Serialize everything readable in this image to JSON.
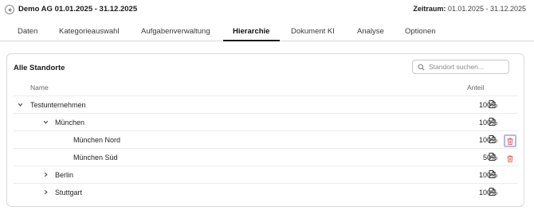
{
  "header": {
    "title": "Demo AG 01.01.2025 - 31.12.2025",
    "period_label": "Zeitraum:",
    "period_value": "01.01.2025 - 31.12.2025"
  },
  "tabs": [
    {
      "label": "Daten",
      "active": false
    },
    {
      "label": "Kategorieauswahl",
      "active": false
    },
    {
      "label": "Aufgabenverwaltung",
      "active": false
    },
    {
      "label": "Hierarchie",
      "active": true
    },
    {
      "label": "Dokument KI",
      "active": false
    },
    {
      "label": "Analyse",
      "active": false
    },
    {
      "label": "Optionen",
      "active": false
    }
  ],
  "panel": {
    "title": "Alle Standorte",
    "search_placeholder": "Standort suchen...",
    "columns": {
      "name": "Name",
      "share": "Anteil"
    },
    "rows": [
      {
        "name": "Testunternehmen",
        "share": "100%",
        "level": 0,
        "toggle": "expanded"
      },
      {
        "name": "München",
        "share": "100%",
        "level": 1,
        "toggle": "expanded"
      },
      {
        "name": "München Nord",
        "share": "100%",
        "level": 2,
        "toggle": "none",
        "deletable": true
      },
      {
        "name": "München Süd",
        "share": "50%",
        "level": 2,
        "toggle": "none",
        "deletable": true
      },
      {
        "name": "Berlin",
        "share": "100%",
        "level": 1,
        "toggle": "collapsed"
      },
      {
        "name": "Stuttgart",
        "share": "100%",
        "level": 1,
        "toggle": "collapsed"
      }
    ]
  },
  "icons": {
    "back": "arrow-left-icon",
    "search": "search-icon",
    "expand": "chevron-down-icon",
    "collapse": "chevron-right-icon",
    "document": "document-icon",
    "delete": "trash-icon"
  },
  "colors": {
    "delete_icon": "#e0605e",
    "focus_ring": "#b9b4f2",
    "active_tab_underline": "#1a1a1a"
  }
}
